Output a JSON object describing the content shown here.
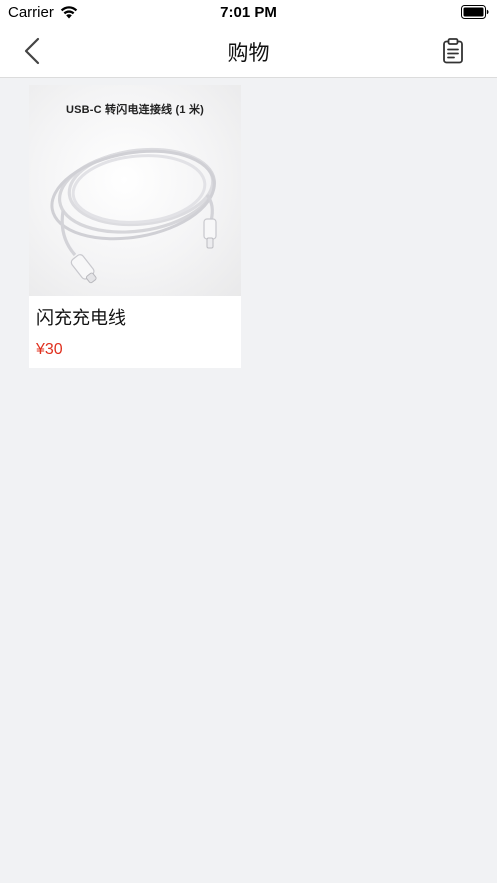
{
  "status_bar": {
    "carrier": "Carrier",
    "time": "7:01 PM",
    "icons": [
      "wifi-icon",
      "battery-icon"
    ]
  },
  "nav": {
    "title": "购物",
    "back_icon": "chevron-left-icon",
    "right_icon": "clipboard-icon"
  },
  "products": [
    {
      "image_caption": "USB-C 转闪电连接线 (1 米)",
      "name": "闪充充电线",
      "price": "¥30"
    }
  ],
  "colors": {
    "background": "#f1f2f4",
    "nav_background": "#ffffff",
    "price": "#e0311f",
    "text": "#111111"
  }
}
